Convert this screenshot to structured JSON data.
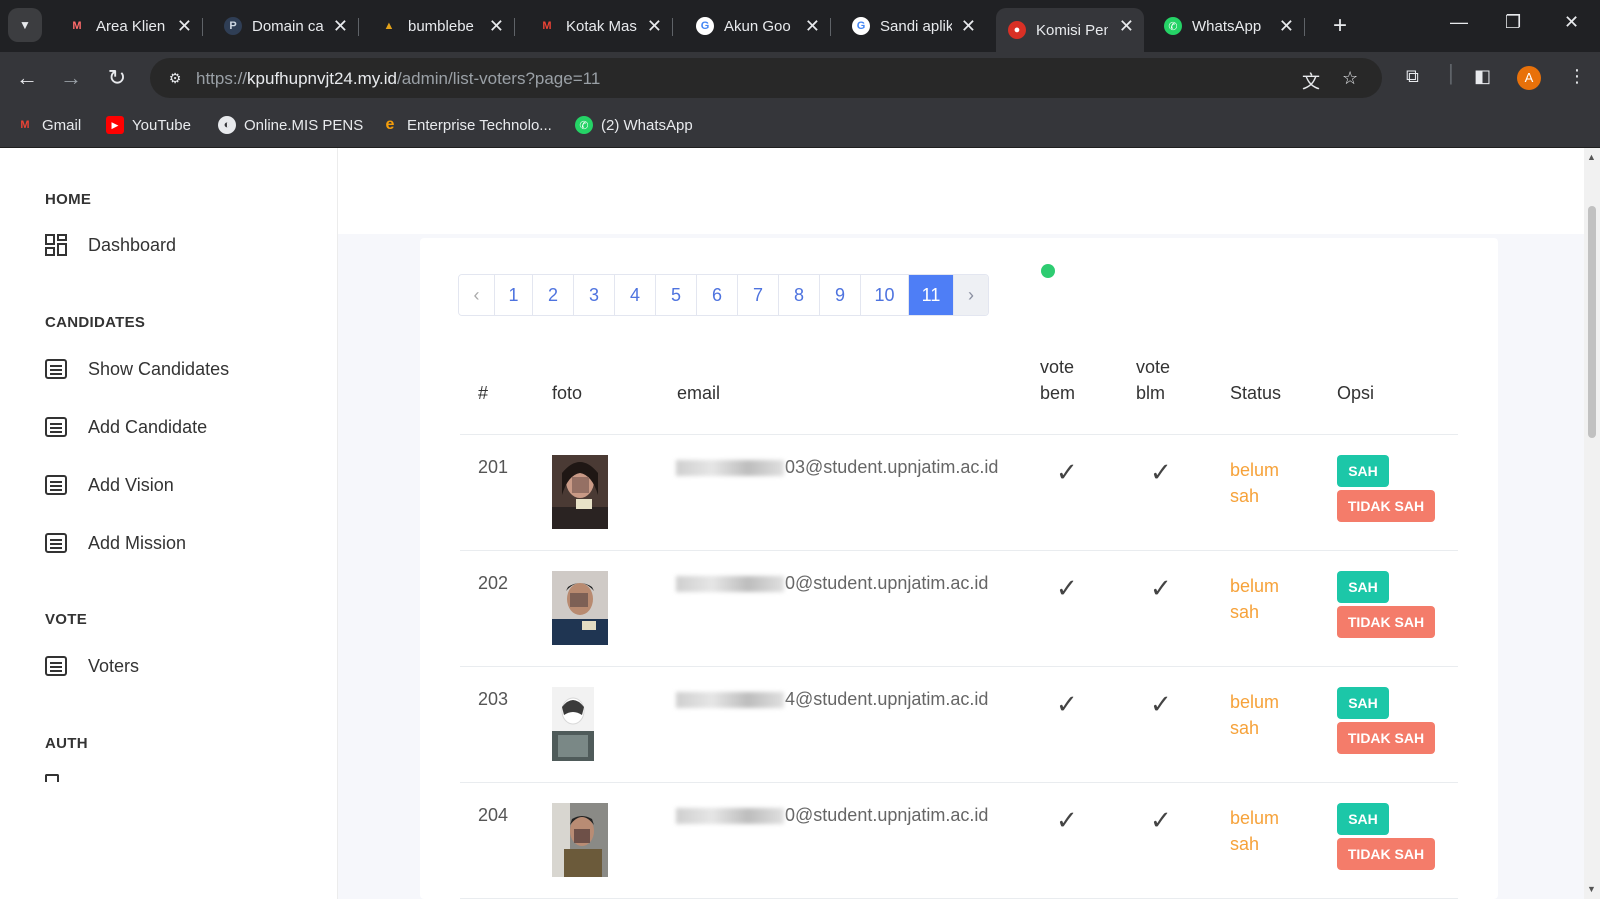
{
  "browser": {
    "tabs": [
      {
        "title": "Area Klien",
        "icon": "area-klien-favicon",
        "color": "#ff6b6b"
      },
      {
        "title": "Domain ca",
        "icon": "domain-favicon",
        "color": "#2f3e55"
      },
      {
        "title": "bumblebe",
        "icon": "bumblebee-favicon",
        "color": "#e3a21a"
      },
      {
        "title": "Kotak Mas",
        "icon": "gmail-favicon",
        "color": "#ea4335"
      },
      {
        "title": "Akun Goo",
        "icon": "google-favicon",
        "color": "#4285f4"
      },
      {
        "title": "Sandi aplik",
        "icon": "google-favicon",
        "color": "#4285f4"
      },
      {
        "title": "Komisi Pen",
        "icon": "komisi-favicon",
        "color": "#d93025"
      },
      {
        "title": "WhatsApp",
        "icon": "whatsapp-favicon",
        "color": "#25d366"
      }
    ],
    "active_tab_index": 6,
    "url_host": "kpufhupnvjt24.my.id",
    "url_prefix": "https://",
    "url_path": "/admin/list-voters?page=11",
    "profile_initial": "A",
    "bookmarks": [
      {
        "label": "Gmail",
        "icon": "gmail-icon"
      },
      {
        "label": "YouTube",
        "icon": "youtube-icon"
      },
      {
        "label": "Online.MIS PENS",
        "icon": "globe-icon"
      },
      {
        "label": "Enterprise Technolo...",
        "icon": "e-icon"
      },
      {
        "label": "(2) WhatsApp",
        "icon": "whatsapp-icon"
      }
    ]
  },
  "sidebar": {
    "sections": [
      {
        "heading": "HOME",
        "items": [
          {
            "label": "Dashboard",
            "icon": "dashboard-icon"
          }
        ]
      },
      {
        "heading": "CANDIDATES",
        "items": [
          {
            "label": "Show Candidates",
            "icon": "list-icon"
          },
          {
            "label": "Add Candidate",
            "icon": "list-icon"
          },
          {
            "label": "Add Vision",
            "icon": "list-icon"
          },
          {
            "label": "Add Mission",
            "icon": "list-icon"
          }
        ]
      },
      {
        "heading": "VOTE",
        "items": [
          {
            "label": "Voters",
            "icon": "list-icon"
          }
        ]
      },
      {
        "heading": "AUTH",
        "items": []
      }
    ]
  },
  "pagination": {
    "prev": "‹",
    "next": "›",
    "pages": [
      "1",
      "2",
      "3",
      "4",
      "5",
      "6",
      "7",
      "8",
      "9",
      "10",
      "11"
    ],
    "current": "11"
  },
  "table": {
    "headers": {
      "num": "#",
      "foto": "foto",
      "email": "email",
      "vote_bem_1": "vote",
      "vote_bem_2": "bem",
      "vote_blm_1": "vote",
      "vote_blm_2": "blm",
      "status": "Status",
      "opsi": "Opsi"
    },
    "rows": [
      {
        "num": "201",
        "email_visible": "03@student.upnjatim.ac.id",
        "vote_bem": "✓",
        "vote_blm": "✓",
        "status_1": "belum",
        "status_2": "sah",
        "sah": "SAH",
        "tidak_sah": "TIDAK SAH"
      },
      {
        "num": "202",
        "email_visible": "0@student.upnjatim.ac.id",
        "vote_bem": "✓",
        "vote_blm": "✓",
        "status_1": "belum",
        "status_2": "sah",
        "sah": "SAH",
        "tidak_sah": "TIDAK SAH"
      },
      {
        "num": "203",
        "email_visible": "4@student.upnjatim.ac.id",
        "vote_bem": "✓",
        "vote_blm": "✓",
        "status_1": "belum",
        "status_2": "sah",
        "sah": "SAH",
        "tidak_sah": "TIDAK SAH"
      },
      {
        "num": "204",
        "email_visible": "0@student.upnjatim.ac.id",
        "vote_bem": "✓",
        "vote_blm": "✓",
        "status_1": "belum",
        "status_2": "sah",
        "sah": "SAH",
        "tidak_sah": "TIDAK SAH"
      }
    ]
  },
  "colors": {
    "accent": "#4e7ef6",
    "sah": "#1cc7a8",
    "tidak_sah": "#f47c6a",
    "status": "#f6a23a",
    "online_dot": "#2ecc71"
  }
}
